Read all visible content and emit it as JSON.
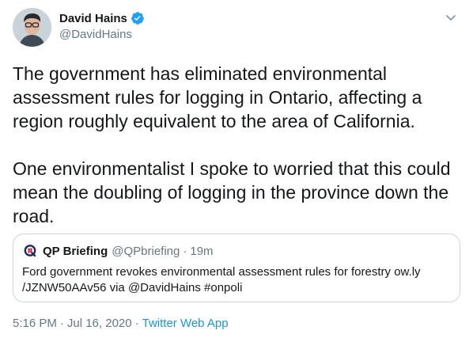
{
  "author": {
    "display_name": "David Hains",
    "handle": "@DavidHains",
    "verified_icon": "verified-badge-icon"
  },
  "tweet": {
    "text": "The government has eliminated environmental assessment rules for logging in Ontario, affecting a region roughly equivalent to the area of California.\n\nOne environmentalist I spoke to worried that this could mean the doubling of logging in the province down the road."
  },
  "quoted_tweet": {
    "display_name": "QP Briefing",
    "handle": "@QPbriefing",
    "separator": "·",
    "time": "19m",
    "text": "Ford government revokes environmental assessment rules for forestry ow.ly /JZNW50AAv56 via @DavidHains #onpoli"
  },
  "meta": {
    "time": "5:16 PM",
    "separator": "·",
    "date": "Jul 16, 2020",
    "separator2": "·",
    "source": "Twitter Web App"
  },
  "colors": {
    "accent": "#1da1f2",
    "link": "#1b95e0",
    "muted": "#657786",
    "text": "#14171a",
    "border": "#ccd6dd"
  }
}
